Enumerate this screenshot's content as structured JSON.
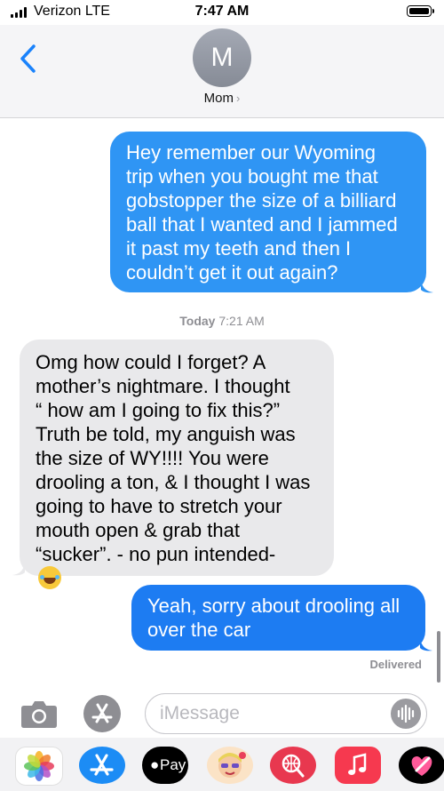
{
  "status_bar": {
    "carrier": "Verizon  LTE",
    "time": "7:47 AM"
  },
  "header": {
    "avatar_initial": "M",
    "contact_name": "Mom",
    "chevron": "›"
  },
  "messages": [
    {
      "direction": "sent",
      "lines": [
        "Hey remember our Wyoming",
        "trip when you bought me that",
        "gobstopper the size of a billiard",
        "ball that I wanted and I jammed",
        "it past my teeth and then I",
        "couldn’t get it out again?"
      ]
    },
    {
      "timestamp_day": "Today",
      "timestamp_time": "7:21 AM"
    },
    {
      "direction": "received",
      "lines": [
        "Omg how could I forget? A",
        "mother’s nightmare. I thought",
        "“ how am I going to fix this?”",
        "Truth be told, my anguish was",
        "the size of WY!!!! You were",
        "drooling a ton, & I thought I was",
        "going to have to stretch your",
        "mouth open & grab that",
        "“sucker”. - no pun intended-"
      ],
      "emoji": "face-with-tears-of-joy"
    },
    {
      "direction": "sent",
      "lines": [
        "Yeah, sorry about drooling all",
        "over the car"
      ],
      "status": "Delivered"
    }
  ],
  "compose": {
    "placeholder": "iMessage"
  },
  "app_drawer": {
    "items": [
      "Photos",
      "App Store",
      "Pay",
      "Memoji",
      "Search Images",
      "Music",
      "Digital Touch"
    ],
    "pay_label": "Pay"
  },
  "colors": {
    "sent_bubble": "#2f95f4",
    "sent_bubble_latest": "#1d7cf2",
    "received_bubble": "#e9e9eb",
    "ios_blue": "#1a82fb"
  }
}
